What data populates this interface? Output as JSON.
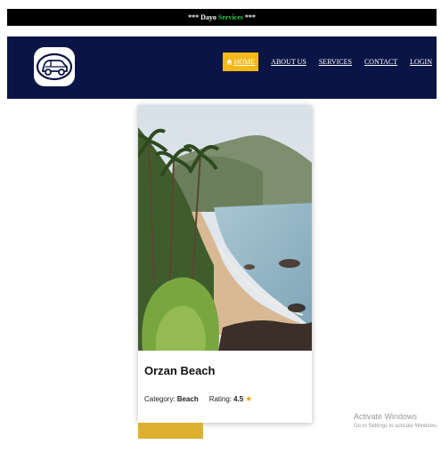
{
  "topbar": {
    "prefix": "*** Dayo ",
    "highlight": "Services",
    "suffix": " ***"
  },
  "nav": {
    "items": [
      {
        "label": "HOME",
        "icon": "home-icon",
        "active": true
      },
      {
        "label": "ABOUT US"
      },
      {
        "label": "SERVICES"
      },
      {
        "label": "CONTACT"
      },
      {
        "label": "LOGIN"
      }
    ]
  },
  "card": {
    "image": "beach-photo",
    "title": "Orzan Beach",
    "category_label": "Category:",
    "category_value": "Beach",
    "rating_label": "Rating:",
    "rating_value": "4.5",
    "rating_icon": "star-icon"
  },
  "watermark": {
    "line1": "Activate Windows",
    "line2": "Go to Settings to activate Windows."
  },
  "colors": {
    "topbar_bg": "#000000",
    "accent_green": "#27c93f",
    "navbar_bg": "#0b1446",
    "active_nav_bg": "#f5b816",
    "star": "#e8a81c",
    "yellow_bar": "#ddb12f"
  }
}
